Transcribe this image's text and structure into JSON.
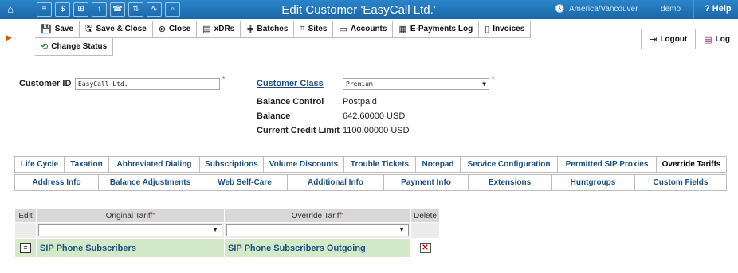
{
  "header": {
    "title": "Edit Customer 'EasyCall Ltd.'",
    "timezone": "America/Vancouver",
    "user": "demo",
    "help": "Help"
  },
  "toolbar": {
    "save": "Save",
    "save_close": "Save & Close",
    "close": "Close",
    "xdrs": "xDRs",
    "batches": "Batches",
    "sites": "Sites",
    "accounts": "Accounts",
    "epayments": "E-Payments Log",
    "invoices": "Invoices",
    "change_status": "Change Status",
    "logout": "Logout",
    "log": "Log"
  },
  "customer": {
    "id_label": "Customer ID",
    "id_value": "EasyCall Ltd.",
    "class_label": "Customer Class",
    "class_value": "Premium",
    "balance_control_label": "Balance Control",
    "balance_control_value": "Postpaid",
    "balance_label": "Balance",
    "balance_value": "642.60000 USD",
    "credit_limit_label": "Current Credit Limit",
    "credit_limit_value": "1100.00000 USD"
  },
  "tabs_row1": [
    "Life Cycle",
    "Taxation",
    "Abbreviated Dialing",
    "Subscriptions",
    "Volume Discounts",
    "Trouble Tickets",
    "Notepad",
    "Service Configuration",
    "Permitted SIP Proxies",
    "Override Tariffs"
  ],
  "tabs_row2": [
    "Address Info",
    "Balance Adjustments",
    "Web Self-Care",
    "Additional Info",
    "Payment Info",
    "Extensions",
    "Huntgroups",
    "Custom Fields"
  ],
  "grid": {
    "col_edit": "Edit",
    "col_original": "Original Tariff",
    "col_override": "Override Tariff",
    "col_delete": "Delete",
    "rows": [
      {
        "original": "SIP Phone Subscribers",
        "override": "SIP Phone Subscribers Outgoing"
      }
    ]
  },
  "colors": {
    "accent": "#1b67a8",
    "row_highlight": "#d3e9c8",
    "required": "#dd3333"
  }
}
